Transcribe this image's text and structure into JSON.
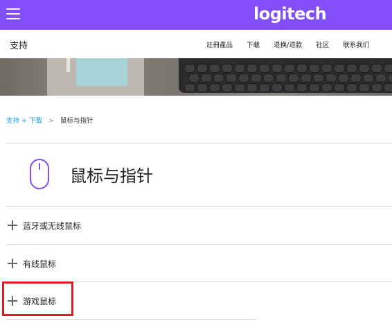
{
  "header": {
    "logo_text": "logitech",
    "brand_color": "#814efa",
    "menu_icon": "hamburger-menu-icon"
  },
  "subnav": {
    "title": "支持",
    "links": [
      "註冊產品",
      "下載",
      "退换/退款",
      "社区",
      "联系我们"
    ]
  },
  "breadcrumb": {
    "link": "支持 + 下载",
    "separator": ">",
    "current": "鼠标与指针",
    "link_color": "#17a3d8"
  },
  "category": {
    "icon": "mouse-icon",
    "title": "鼠标与指针",
    "accent_color": "#814efa"
  },
  "accordion": {
    "items": [
      {
        "label": "蓝牙或无线鼠标",
        "icon": "plus-icon"
      },
      {
        "label": "有线鼠标",
        "icon": "plus-icon"
      },
      {
        "label": "游戏鼠标",
        "icon": "plus-icon"
      }
    ]
  },
  "annotation": {
    "highlight_color": "#e11b1b",
    "highlighted_item": "游戏鼠标"
  }
}
